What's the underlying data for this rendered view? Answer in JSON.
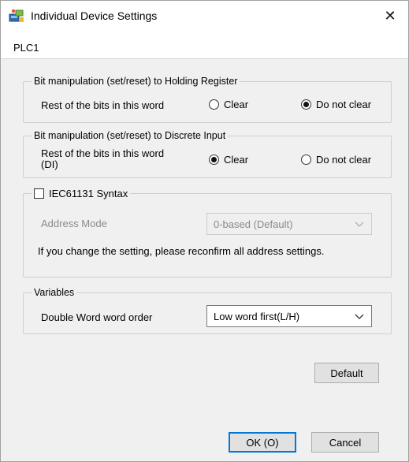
{
  "window": {
    "title": "Individual Device Settings",
    "close_glyph": "✕"
  },
  "tab": {
    "label": "PLC1"
  },
  "holding_register": {
    "legend": "Bit manipulation (set/reset) to Holding Register",
    "rest_label": "Rest of the bits in this word",
    "options": [
      {
        "label": "Clear",
        "checked": false
      },
      {
        "label": "Do not clear",
        "checked": true
      }
    ]
  },
  "discrete_input": {
    "legend": "Bit manipulation (set/reset) to Discrete Input",
    "rest_label_line1": "Rest of the bits in this word",
    "rest_label_line2": "(DI)",
    "options": [
      {
        "label": "Clear",
        "checked": true
      },
      {
        "label": "Do not clear",
        "checked": false
      }
    ]
  },
  "iec": {
    "checkbox_label": "IEC61131 Syntax",
    "checked": false,
    "address_mode_label": "Address Mode",
    "address_mode_value": "0-based (Default)",
    "note": "If you change the setting, please reconfirm all address settings."
  },
  "variables": {
    "legend": "Variables",
    "dword_label": "Double Word word order",
    "dword_value": "Low word first(L/H)"
  },
  "buttons": {
    "default": "Default",
    "ok": "OK (O)",
    "cancel": "Cancel"
  },
  "icons": {
    "app": "device-settings-icon",
    "close": "close-icon",
    "dropdown": "chevron-down-icon"
  }
}
